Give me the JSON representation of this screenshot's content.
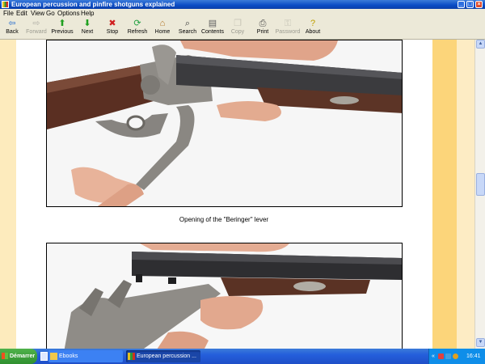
{
  "window": {
    "title": "European percussion and pinfire shotguns explained"
  },
  "menu": [
    "File",
    "Edit",
    "View",
    "Go",
    "Options",
    "Help"
  ],
  "toolbar": {
    "back": "Back",
    "forward": "Forward",
    "previous": "Previous",
    "next": "Next",
    "stop": "Stop",
    "refresh": "Refresh",
    "home": "Home",
    "search": "Search",
    "contents": "Contents",
    "copy": "Copy",
    "print": "Print",
    "password": "Password",
    "about": "About"
  },
  "content": {
    "caption": "Opening of the \"Beringer\" lever"
  },
  "taskbar": {
    "start": "Démarrer",
    "tasks": [
      "Ebooks",
      "European percussion ..."
    ],
    "clock": "16:41"
  }
}
